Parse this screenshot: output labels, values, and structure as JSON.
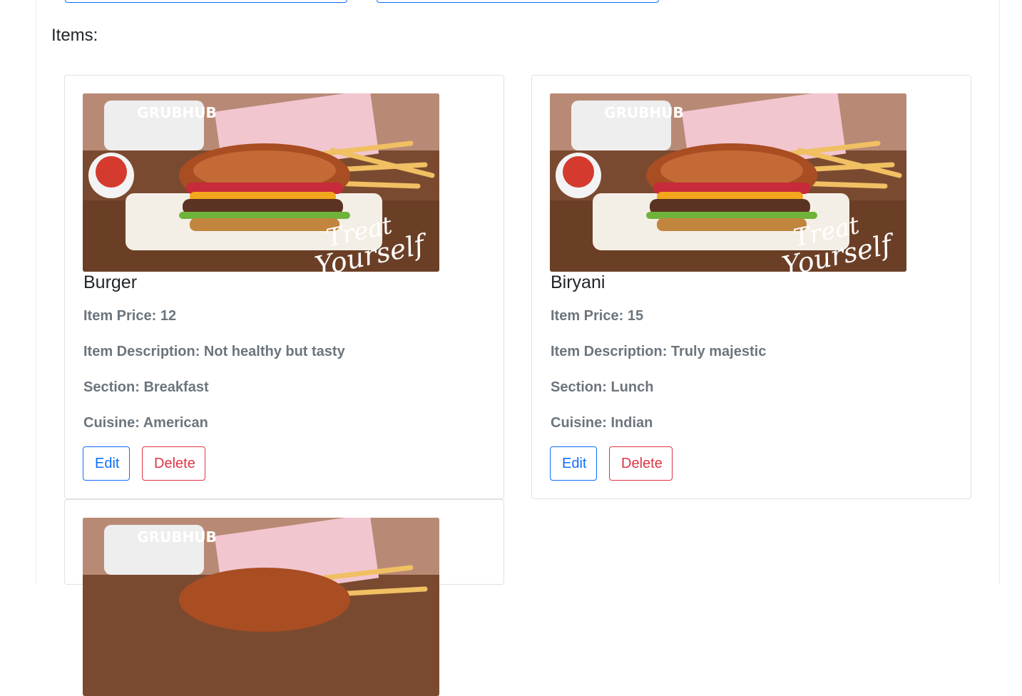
{
  "section": {
    "heading": "Items:"
  },
  "promo_image": {
    "brand": "GRUBHUB",
    "tagline_line1": "Treat",
    "tagline_line2": "Yourself"
  },
  "labels": {
    "price": "Item Price: ",
    "description": "Item Description: ",
    "section": "Section: ",
    "cuisine": "Cuisine: "
  },
  "items": [
    {
      "name": "Burger",
      "price": "12",
      "description": "Not healthy but tasty",
      "section": "Breakfast",
      "cuisine": "American",
      "edit_label": "Edit",
      "delete_label": "Delete"
    },
    {
      "name": "Biryani",
      "price": "15",
      "description": "Truly majestic",
      "section": "Lunch",
      "cuisine": "Indian",
      "edit_label": "Edit",
      "delete_label": "Delete"
    }
  ],
  "colors": {
    "primary": "#0d6efd",
    "danger": "#dc3545",
    "muted": "#6c757d",
    "border": "#dfe1e5"
  }
}
